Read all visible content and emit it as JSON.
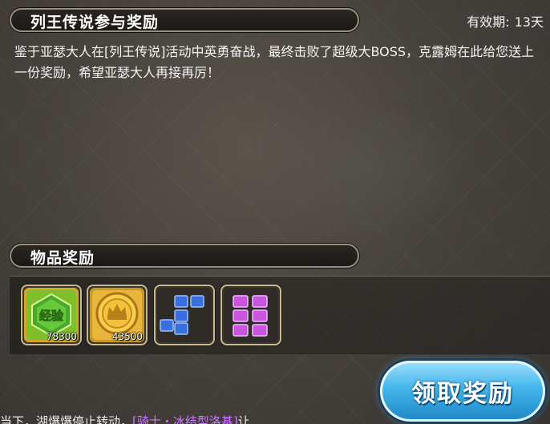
{
  "mail": {
    "title": "列王传说参与奖励",
    "validity_label": "有效期:",
    "validity_value": "13天",
    "message": "鉴于亚瑟大人在[列王传说]活动中英勇奋战，最终击败了超级大BOSS，克露姆在此给您送上一份奖励，希望亚瑟大人再接再厉！"
  },
  "rewards": {
    "title": "物品奖励",
    "items": [
      {
        "icon": "experience-icon",
        "label": "经验",
        "count": "78300"
      },
      {
        "icon": "gold-coin-icon",
        "count": "43500"
      },
      {
        "icon": "blue-blocks-icon"
      },
      {
        "icon": "purple-blocks-icon"
      }
    ]
  },
  "actions": {
    "claim_label": "领取奖励"
  },
  "ticker": {
    "prefix": "当下，湖爆爆停止转动，",
    "highlight": "[骑士・冰结型洛基]",
    "suffix": "让"
  },
  "colors": {
    "accent_blue": "#44b5ea",
    "item_frame": "#c9b98f",
    "purple_block": "#cc55e0",
    "blue_block": "#3a6fe0"
  }
}
